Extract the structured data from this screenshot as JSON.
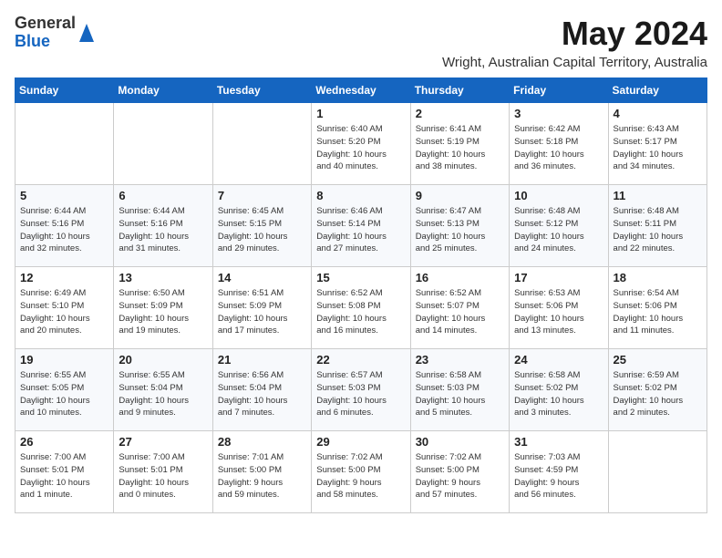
{
  "header": {
    "logo_general": "General",
    "logo_blue": "Blue",
    "month_title": "May 2024",
    "location": "Wright, Australian Capital Territory, Australia"
  },
  "days_of_week": [
    "Sunday",
    "Monday",
    "Tuesday",
    "Wednesday",
    "Thursday",
    "Friday",
    "Saturday"
  ],
  "weeks": [
    [
      {
        "day": "",
        "info": ""
      },
      {
        "day": "",
        "info": ""
      },
      {
        "day": "",
        "info": ""
      },
      {
        "day": "1",
        "info": "Sunrise: 6:40 AM\nSunset: 5:20 PM\nDaylight: 10 hours\nand 40 minutes."
      },
      {
        "day": "2",
        "info": "Sunrise: 6:41 AM\nSunset: 5:19 PM\nDaylight: 10 hours\nand 38 minutes."
      },
      {
        "day": "3",
        "info": "Sunrise: 6:42 AM\nSunset: 5:18 PM\nDaylight: 10 hours\nand 36 minutes."
      },
      {
        "day": "4",
        "info": "Sunrise: 6:43 AM\nSunset: 5:17 PM\nDaylight: 10 hours\nand 34 minutes."
      }
    ],
    [
      {
        "day": "5",
        "info": "Sunrise: 6:44 AM\nSunset: 5:16 PM\nDaylight: 10 hours\nand 32 minutes."
      },
      {
        "day": "6",
        "info": "Sunrise: 6:44 AM\nSunset: 5:16 PM\nDaylight: 10 hours\nand 31 minutes."
      },
      {
        "day": "7",
        "info": "Sunrise: 6:45 AM\nSunset: 5:15 PM\nDaylight: 10 hours\nand 29 minutes."
      },
      {
        "day": "8",
        "info": "Sunrise: 6:46 AM\nSunset: 5:14 PM\nDaylight: 10 hours\nand 27 minutes."
      },
      {
        "day": "9",
        "info": "Sunrise: 6:47 AM\nSunset: 5:13 PM\nDaylight: 10 hours\nand 25 minutes."
      },
      {
        "day": "10",
        "info": "Sunrise: 6:48 AM\nSunset: 5:12 PM\nDaylight: 10 hours\nand 24 minutes."
      },
      {
        "day": "11",
        "info": "Sunrise: 6:48 AM\nSunset: 5:11 PM\nDaylight: 10 hours\nand 22 minutes."
      }
    ],
    [
      {
        "day": "12",
        "info": "Sunrise: 6:49 AM\nSunset: 5:10 PM\nDaylight: 10 hours\nand 20 minutes."
      },
      {
        "day": "13",
        "info": "Sunrise: 6:50 AM\nSunset: 5:09 PM\nDaylight: 10 hours\nand 19 minutes."
      },
      {
        "day": "14",
        "info": "Sunrise: 6:51 AM\nSunset: 5:09 PM\nDaylight: 10 hours\nand 17 minutes."
      },
      {
        "day": "15",
        "info": "Sunrise: 6:52 AM\nSunset: 5:08 PM\nDaylight: 10 hours\nand 16 minutes."
      },
      {
        "day": "16",
        "info": "Sunrise: 6:52 AM\nSunset: 5:07 PM\nDaylight: 10 hours\nand 14 minutes."
      },
      {
        "day": "17",
        "info": "Sunrise: 6:53 AM\nSunset: 5:06 PM\nDaylight: 10 hours\nand 13 minutes."
      },
      {
        "day": "18",
        "info": "Sunrise: 6:54 AM\nSunset: 5:06 PM\nDaylight: 10 hours\nand 11 minutes."
      }
    ],
    [
      {
        "day": "19",
        "info": "Sunrise: 6:55 AM\nSunset: 5:05 PM\nDaylight: 10 hours\nand 10 minutes."
      },
      {
        "day": "20",
        "info": "Sunrise: 6:55 AM\nSunset: 5:04 PM\nDaylight: 10 hours\nand 9 minutes."
      },
      {
        "day": "21",
        "info": "Sunrise: 6:56 AM\nSunset: 5:04 PM\nDaylight: 10 hours\nand 7 minutes."
      },
      {
        "day": "22",
        "info": "Sunrise: 6:57 AM\nSunset: 5:03 PM\nDaylight: 10 hours\nand 6 minutes."
      },
      {
        "day": "23",
        "info": "Sunrise: 6:58 AM\nSunset: 5:03 PM\nDaylight: 10 hours\nand 5 minutes."
      },
      {
        "day": "24",
        "info": "Sunrise: 6:58 AM\nSunset: 5:02 PM\nDaylight: 10 hours\nand 3 minutes."
      },
      {
        "day": "25",
        "info": "Sunrise: 6:59 AM\nSunset: 5:02 PM\nDaylight: 10 hours\nand 2 minutes."
      }
    ],
    [
      {
        "day": "26",
        "info": "Sunrise: 7:00 AM\nSunset: 5:01 PM\nDaylight: 10 hours\nand 1 minute."
      },
      {
        "day": "27",
        "info": "Sunrise: 7:00 AM\nSunset: 5:01 PM\nDaylight: 10 hours\nand 0 minutes."
      },
      {
        "day": "28",
        "info": "Sunrise: 7:01 AM\nSunset: 5:00 PM\nDaylight: 9 hours\nand 59 minutes."
      },
      {
        "day": "29",
        "info": "Sunrise: 7:02 AM\nSunset: 5:00 PM\nDaylight: 9 hours\nand 58 minutes."
      },
      {
        "day": "30",
        "info": "Sunrise: 7:02 AM\nSunset: 5:00 PM\nDaylight: 9 hours\nand 57 minutes."
      },
      {
        "day": "31",
        "info": "Sunrise: 7:03 AM\nSunset: 4:59 PM\nDaylight: 9 hours\nand 56 minutes."
      },
      {
        "day": "",
        "info": ""
      }
    ]
  ]
}
